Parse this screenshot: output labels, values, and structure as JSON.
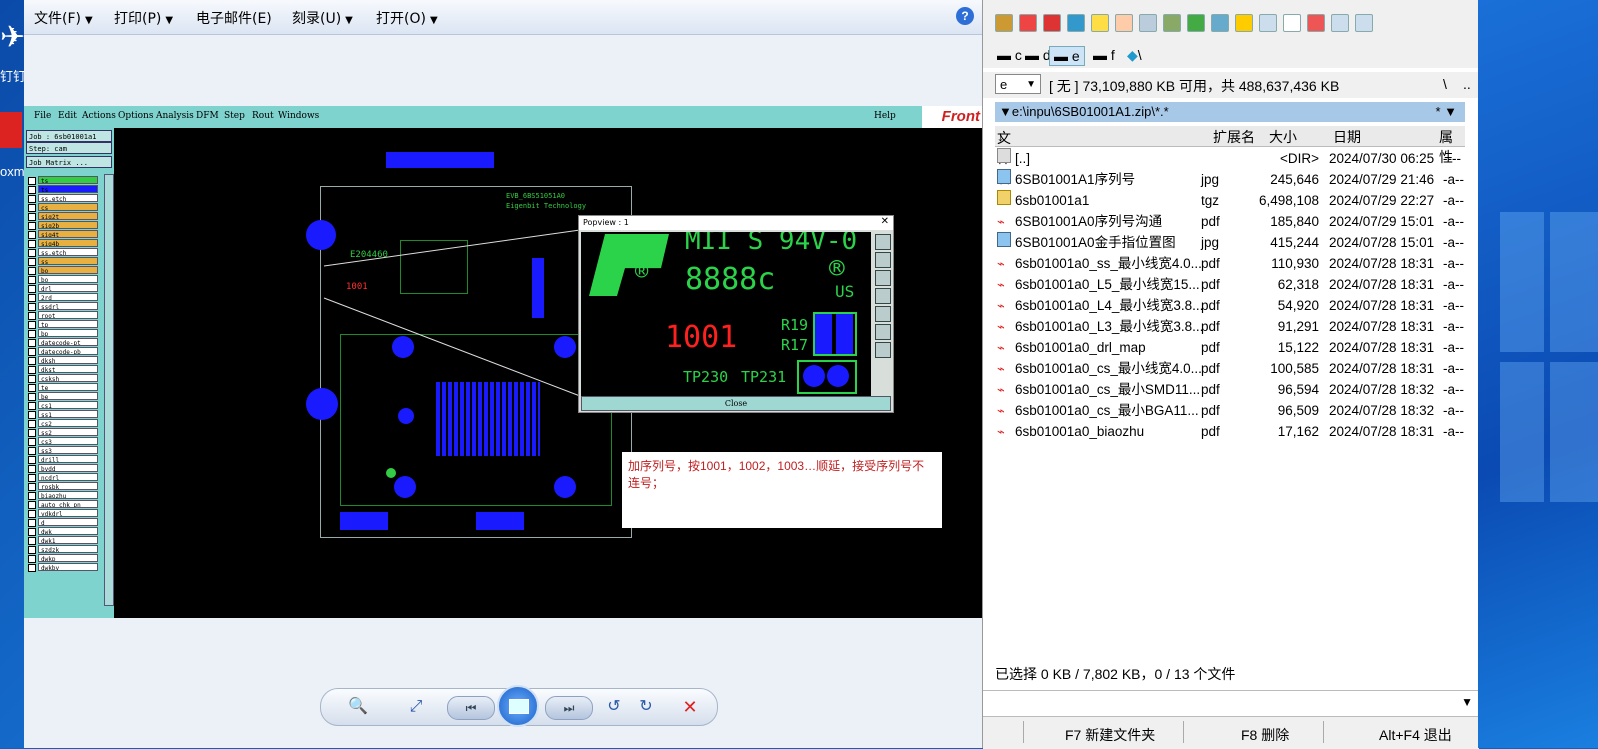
{
  "desktop": {
    "icon_label_1": "钉钉",
    "icon_label_2": "oxm"
  },
  "viewer": {
    "menu": [
      {
        "label": "文件(F)",
        "caret": true
      },
      {
        "label": "打印(P)",
        "caret": true
      },
      {
        "label": "电子邮件(E)",
        "caret": false
      },
      {
        "label": "刻录(U)",
        "caret": true
      },
      {
        "label": "打开(O)",
        "caret": true
      }
    ],
    "help_label": "?",
    "toolbar": {
      "zoom": "🔍",
      "fit": "⤢",
      "prev": "⏮",
      "next": "⏭",
      "rotate_ccw": "↺",
      "rotate_cw": "↻",
      "delete": "✕"
    }
  },
  "cam": {
    "menu": [
      "File",
      "Edit",
      "Actions",
      "Options",
      "Analysis",
      "DFM",
      "Step",
      "Rout",
      "Windows"
    ],
    "help": "Help",
    "logo": "Front",
    "job": "Job : 6sb01001a1",
    "step": "Step: cam",
    "job_matrix": "Job Matrix ...",
    "layers": [
      "ts",
      "ts",
      "ss.etch",
      "cs",
      "sig2t",
      "sig2b",
      "sig4t",
      "sig4b",
      "ss.etch",
      "ss",
      "bo",
      "bo",
      "drl",
      "2rd",
      "ssdrl",
      "root",
      "tp",
      "bp",
      "datecode-pt",
      "datecode-pb",
      "dksh",
      "dkst",
      "csksh",
      "te",
      "be",
      "cs1",
      "ss1",
      "cs2",
      "ss2",
      "cs3",
      "ss3",
      "drill",
      "bydd",
      "ncdrl",
      "rosbk",
      "biaozhu",
      "auto_chk_pn",
      "ydkdrl",
      "d",
      "dwk",
      "dwk1",
      "szdzk",
      "dwkp",
      "dwkby"
    ],
    "layer_colors": [
      "#33cc44",
      "#1a1aff",
      "#ffffff",
      "#e8b040",
      "#e8b040",
      "#e8b040",
      "#e8b040",
      "#e8b040",
      "#ffffff",
      "#e8b040",
      "#e8b040",
      "#ffffff",
      "#ffffff",
      "#ffffff",
      "#ffffff",
      "#ffffff",
      "#ffffff",
      "#ffffff",
      "#ffffff",
      "#ffffff",
      "#ffffff",
      "#ffffff",
      "#ffffff",
      "#ffffff",
      "#ffffff",
      "#ffffff",
      "#ffffff",
      "#ffffff",
      "#ffffff",
      "#ffffff",
      "#ffffff",
      "#ffffff",
      "#ffffff",
      "#ffffff",
      "#ffffff",
      "#ffffff",
      "#ffffff",
      "#ffffff",
      "#ffffff",
      "#ffffff",
      "#ffffff",
      "#ffffff",
      "#ffffff",
      "#ffffff"
    ],
    "pcb_text": {
      "company_1": "EVB_6BS51051A0",
      "company_2": "Eigenbit Technology",
      "code": "E204460",
      "sn": "1001"
    },
    "popview": {
      "title": "Popview : 1",
      "marking": "MII S 94V-0",
      "date_code": "8888c",
      "serial": "1001",
      "r1": "R19",
      "r2": "R17",
      "tp1": "TP230",
      "tp2": "TP231",
      "us": "US",
      "close": "Close"
    },
    "annotation": "加序列号，按1001，1002，1003…顺延，接受序列号不连号；"
  },
  "tc": {
    "drives": [
      "c",
      "d",
      "e",
      "f",
      "\\"
    ],
    "active_drive": "e",
    "drive_select": "e",
    "disk_info": "[ 无 ]  73,109,880 KB 可用，共 488,637,436 KB",
    "disk_nav_1": "\\",
    "disk_nav_2": "..",
    "path": "e:\\inpu\\6SB01001A1.zip\\*.*",
    "path_star": "*",
    "columns": {
      "name": "文件名",
      "ext": "扩展名",
      "size": "大小",
      "date": "日期",
      "attr": "属性"
    },
    "files": [
      {
        "icon": "dir",
        "name": "[..]",
        "ext": "",
        "size": "<DIR>",
        "date": "2024/07/30 06:25",
        "attr": "----"
      },
      {
        "icon": "jpg",
        "name": "6SB01001A1序列号",
        "ext": "jpg",
        "size": "245,646",
        "date": "2024/07/29 21:46",
        "attr": "-a--"
      },
      {
        "icon": "tgz",
        "name": "6sb01001a1",
        "ext": "tgz",
        "size": "6,498,108",
        "date": "2024/07/29 22:27",
        "attr": "-a--"
      },
      {
        "icon": "pdf",
        "name": "6SB01001A0序列号沟通",
        "ext": "pdf",
        "size": "185,840",
        "date": "2024/07/29 15:01",
        "attr": "-a--"
      },
      {
        "icon": "jpg",
        "name": "6SB01001A0金手指位置图",
        "ext": "jpg",
        "size": "415,244",
        "date": "2024/07/28 15:01",
        "attr": "-a--"
      },
      {
        "icon": "pdf",
        "name": "6sb01001a0_ss_最小线宽4.0...",
        "ext": "pdf",
        "size": "110,930",
        "date": "2024/07/28 18:31",
        "attr": "-a--"
      },
      {
        "icon": "pdf",
        "name": "6sb01001a0_L5_最小线宽15...",
        "ext": "pdf",
        "size": "62,318",
        "date": "2024/07/28 18:31",
        "attr": "-a--"
      },
      {
        "icon": "pdf",
        "name": "6sb01001a0_L4_最小线宽3.8...",
        "ext": "pdf",
        "size": "54,920",
        "date": "2024/07/28 18:31",
        "attr": "-a--"
      },
      {
        "icon": "pdf",
        "name": "6sb01001a0_L3_最小线宽3.8...",
        "ext": "pdf",
        "size": "91,291",
        "date": "2024/07/28 18:31",
        "attr": "-a--"
      },
      {
        "icon": "pdf",
        "name": "6sb01001a0_drl_map",
        "ext": "pdf",
        "size": "15,122",
        "date": "2024/07/28 18:31",
        "attr": "-a--"
      },
      {
        "icon": "pdf",
        "name": "6sb01001a0_cs_最小线宽4.0...",
        "ext": "pdf",
        "size": "100,585",
        "date": "2024/07/28 18:31",
        "attr": "-a--"
      },
      {
        "icon": "pdf",
        "name": "6sb01001a0_cs_最小SMD11...",
        "ext": "pdf",
        "size": "96,594",
        "date": "2024/07/28 18:32",
        "attr": "-a--"
      },
      {
        "icon": "pdf",
        "name": "6sb01001a0_cs_最小BGA11...",
        "ext": "pdf",
        "size": "96,509",
        "date": "2024/07/28 18:32",
        "attr": "-a--"
      },
      {
        "icon": "pdf",
        "name": "6sb01001a0_biaozhu",
        "ext": "pdf",
        "size": "17,162",
        "date": "2024/07/28 18:31",
        "attr": "-a--"
      }
    ],
    "status": "已选择 0 KB / 7,802 KB，0 / 13 个文件",
    "fkeys": [
      "F7 新建文件夹",
      "F8 删除",
      "Alt+F4 退出"
    ]
  }
}
